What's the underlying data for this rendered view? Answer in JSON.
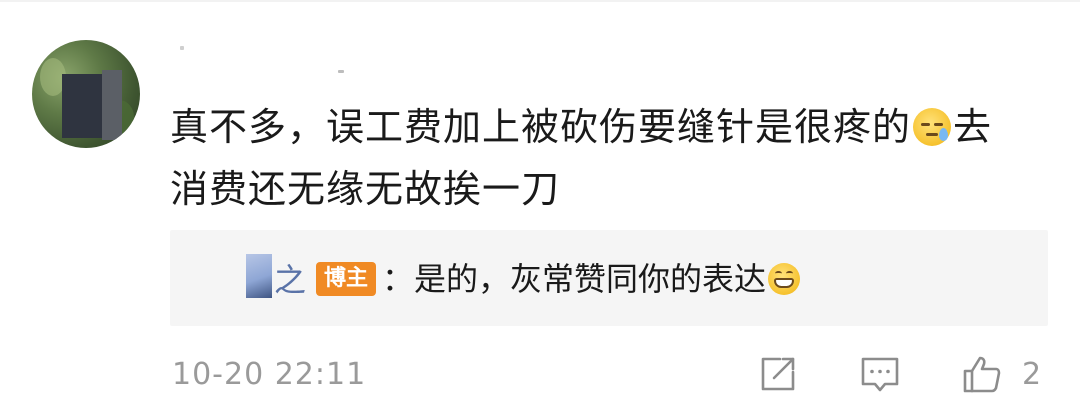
{
  "comment": {
    "text_line1": "真不多，误工费加上被砍伤要缝针是很疼的",
    "emoji1": "sweat-face-emoji",
    "text_line1_end": "去",
    "text_line2": "消费还无缘无故挨一刀"
  },
  "reply": {
    "name_tail": "之",
    "badge": "博主",
    "text": "：是的，灰常赞同你的表达",
    "emoji": "grinning-face-emoji"
  },
  "meta": {
    "timestamp": "10-20 22:11",
    "like_count": "2"
  },
  "icons": {
    "share": "share-icon",
    "comment": "comment-icon",
    "like": "thumbs-up-icon"
  },
  "colors": {
    "badge_bg": "#f08a24",
    "reply_bg": "#f5f5f5",
    "meta_text": "#9a9a9a"
  }
}
